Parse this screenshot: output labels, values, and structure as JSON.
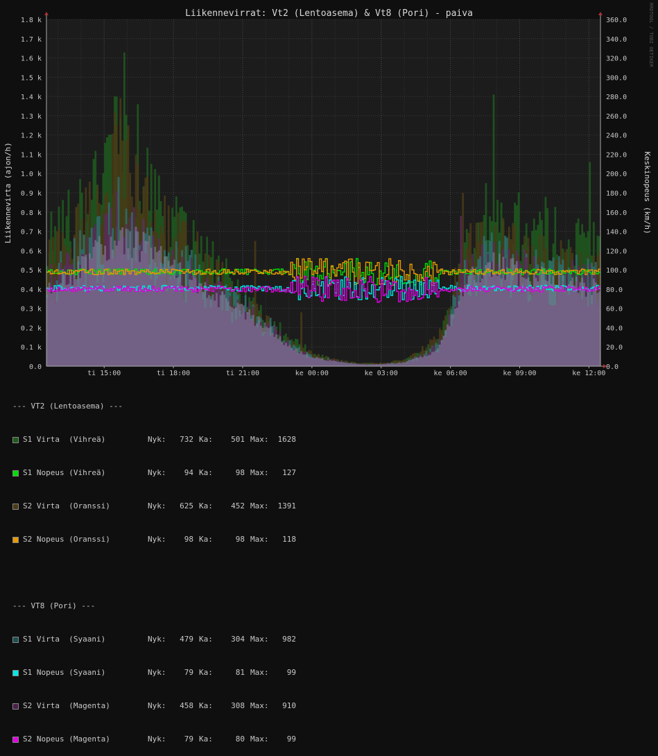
{
  "chart_data": {
    "type": "area",
    "title": "Liikennevirrat: Vt2 (Lentoasema) & Vt8 (Pori) - paiva",
    "watermark": "RRDTOOL / TOBI OETIKER",
    "left_axis": {
      "label": "Liikennevirta (ajon/h)",
      "ticks": [
        "0.0",
        "0.1 k",
        "0.2 k",
        "0.3 k",
        "0.4 k",
        "0.5 k",
        "0.6 k",
        "0.7 k",
        "0.8 k",
        "0.9 k",
        "1.0 k",
        "1.1 k",
        "1.2 k",
        "1.3 k",
        "1.4 k",
        "1.5 k",
        "1.6 k",
        "1.7 k",
        "1.8 k"
      ],
      "range": [
        0,
        1800
      ]
    },
    "right_axis": {
      "label": "Keskinopeus (km/h)",
      "ticks": [
        "0.0",
        "20.0",
        "40.0",
        "60.0",
        "80.0",
        "100.0",
        "120.0",
        "140.0",
        "160.0",
        "180.0",
        "200.0",
        "220.0",
        "240.0",
        "260.0",
        "280.0",
        "300.0",
        "320.0",
        "340.0",
        "360.0"
      ],
      "range": [
        0,
        360
      ]
    },
    "x_axis": {
      "range_hours": [
        12.5,
        36.5
      ],
      "ticks": [
        {
          "h": 15,
          "label": "ti 15:00"
        },
        {
          "h": 18,
          "label": "ti 18:00"
        },
        {
          "h": 21,
          "label": "ti 21:00"
        },
        {
          "h": 24,
          "label": "ke 00:00"
        },
        {
          "h": 27,
          "label": "ke 03:00"
        },
        {
          "h": 30,
          "label": "ke 06:00"
        },
        {
          "h": 33,
          "label": "ke 09:00"
        },
        {
          "h": 36,
          "label": "ke 12:00"
        }
      ]
    },
    "grid": true,
    "series": [
      {
        "id": "s1_virta_vt2",
        "axis": "left",
        "kind": "area",
        "color": "#1f5a1f",
        "profile": [
          [
            12.5,
            600
          ],
          [
            13.5,
            750
          ],
          [
            14.5,
            880
          ],
          [
            15.5,
            1200
          ],
          [
            16.0,
            1000
          ],
          [
            17.0,
            850
          ],
          [
            18.0,
            700
          ],
          [
            19.0,
            580
          ],
          [
            20.0,
            460
          ],
          [
            21.0,
            360
          ],
          [
            22.0,
            250
          ],
          [
            23.0,
            130
          ],
          [
            24.0,
            70
          ],
          [
            25.0,
            30
          ],
          [
            26.0,
            15
          ],
          [
            27.0,
            15
          ],
          [
            28.0,
            30
          ],
          [
            29.0,
            90
          ],
          [
            29.5,
            150
          ],
          [
            30.0,
            300
          ],
          [
            30.5,
            500
          ],
          [
            31.0,
            650
          ],
          [
            31.5,
            700
          ],
          [
            32.0,
            750
          ],
          [
            33.0,
            720
          ],
          [
            34.0,
            680
          ],
          [
            35.0,
            640
          ],
          [
            36.0,
            620
          ],
          [
            36.5,
            600
          ]
        ],
        "peaks": [
          [
            15.8,
            1628
          ],
          [
            15.5,
            1400
          ],
          [
            16.4,
            1360
          ],
          [
            31.8,
            1410
          ],
          [
            31.5,
            950
          ],
          [
            36.0,
            1060
          ],
          [
            17.0,
            1050
          ],
          [
            14.0,
            900
          ]
        ]
      },
      {
        "id": "s2_virta_vt2",
        "axis": "left",
        "kind": "area",
        "color": "#4a3a16",
        "profile": [
          [
            12.5,
            550
          ],
          [
            13.5,
            650
          ],
          [
            14.5,
            800
          ],
          [
            15.5,
            1050
          ],
          [
            16.0,
            950
          ],
          [
            17.0,
            780
          ],
          [
            18.0,
            640
          ],
          [
            19.0,
            540
          ],
          [
            20.0,
            430
          ],
          [
            21.0,
            330
          ],
          [
            22.0,
            220
          ],
          [
            23.0,
            110
          ],
          [
            24.0,
            60
          ],
          [
            25.0,
            30
          ],
          [
            26.0,
            15
          ],
          [
            27.0,
            15
          ],
          [
            28.0,
            30
          ],
          [
            29.0,
            100
          ],
          [
            29.5,
            170
          ],
          [
            30.0,
            330
          ],
          [
            30.5,
            550
          ],
          [
            31.0,
            600
          ],
          [
            31.5,
            600
          ],
          [
            32.0,
            620
          ],
          [
            33.0,
            560
          ],
          [
            34.0,
            520
          ],
          [
            35.0,
            500
          ],
          [
            36.0,
            480
          ],
          [
            36.5,
            470
          ]
        ],
        "peaks": [
          [
            15.7,
            1391
          ],
          [
            16.0,
            1250
          ],
          [
            30.5,
            900
          ],
          [
            21.5,
            650
          ],
          [
            23.5,
            280
          ]
        ]
      },
      {
        "id": "s1_virta_vt8",
        "axis": "left",
        "kind": "area",
        "color": "#2e6f6f",
        "profile": [
          [
            12.5,
            420
          ],
          [
            13.5,
            500
          ],
          [
            14.5,
            620
          ],
          [
            15.5,
            720
          ],
          [
            16.0,
            700
          ],
          [
            17.0,
            620
          ],
          [
            18.0,
            520
          ],
          [
            19.0,
            450
          ],
          [
            20.0,
            370
          ],
          [
            21.0,
            300
          ],
          [
            22.0,
            210
          ],
          [
            23.0,
            110
          ],
          [
            24.0,
            50
          ],
          [
            25.0,
            25
          ],
          [
            26.0,
            10
          ],
          [
            27.0,
            10
          ],
          [
            28.0,
            20
          ],
          [
            29.0,
            70
          ],
          [
            29.5,
            120
          ],
          [
            30.0,
            260
          ],
          [
            30.5,
            420
          ],
          [
            31.0,
            520
          ],
          [
            31.5,
            560
          ],
          [
            32.0,
            560
          ],
          [
            33.0,
            520
          ],
          [
            34.0,
            480
          ],
          [
            35.0,
            460
          ],
          [
            36.0,
            440
          ],
          [
            36.5,
            430
          ]
        ],
        "peaks": [
          [
            15.6,
            982
          ],
          [
            15.2,
            850
          ]
        ]
      },
      {
        "id": "s2_virta_vt8",
        "axis": "left",
        "kind": "area",
        "color": "#5a2a5a",
        "profile": [
          [
            12.5,
            400
          ],
          [
            13.5,
            470
          ],
          [
            14.5,
            580
          ],
          [
            15.5,
            680
          ],
          [
            16.0,
            660
          ],
          [
            17.0,
            590
          ],
          [
            18.0,
            500
          ],
          [
            19.0,
            430
          ],
          [
            20.0,
            350
          ],
          [
            21.0,
            280
          ],
          [
            22.0,
            200
          ],
          [
            23.0,
            100
          ],
          [
            24.0,
            45
          ],
          [
            25.0,
            25
          ],
          [
            26.0,
            10
          ],
          [
            27.0,
            10
          ],
          [
            28.0,
            20
          ],
          [
            29.0,
            60
          ],
          [
            29.5,
            110
          ],
          [
            30.0,
            240
          ],
          [
            30.5,
            420
          ],
          [
            31.0,
            500
          ],
          [
            31.5,
            520
          ],
          [
            32.0,
            520
          ],
          [
            33.0,
            480
          ],
          [
            34.0,
            450
          ],
          [
            35.0,
            430
          ],
          [
            36.0,
            420
          ],
          [
            36.5,
            410
          ]
        ],
        "peaks": [
          [
            15.5,
            910
          ],
          [
            30.4,
            780
          ]
        ]
      },
      {
        "id": "s1_nopeus_vt2",
        "axis": "right",
        "kind": "line",
        "color": "#00e000",
        "base": 98,
        "noise": 3,
        "night_noise": 14
      },
      {
        "id": "s2_nopeus_vt2",
        "axis": "right",
        "kind": "line",
        "color": "#e89a00",
        "base": 98,
        "noise": 3,
        "night_noise": 14
      },
      {
        "id": "s1_nopeus_vt8",
        "axis": "right",
        "kind": "line",
        "color": "#00e8e8",
        "base": 81,
        "noise": 3,
        "night_noise": 12
      },
      {
        "id": "s2_nopeus_vt8",
        "axis": "right",
        "kind": "line",
        "color": "#e000e0",
        "base": 80,
        "noise": 3,
        "night_noise": 14
      }
    ]
  },
  "legend": {
    "groups": [
      {
        "header": "--- VT2 (Lentoasema) ---",
        "rows": [
          {
            "name": "S1 Virta  (Vihreä)",
            "color": "#1f5a1f",
            "nyk": "732",
            "ka": "501",
            "max": "1628"
          },
          {
            "name": "S1 Nopeus (Vihreä)",
            "color": "#00e000",
            "nyk": "94",
            "ka": "98",
            "max": "127"
          },
          {
            "name": "S2 Virta  (Oranssi)",
            "color": "#4a3a16",
            "nyk": "625",
            "ka": "452",
            "max": "1391"
          },
          {
            "name": "S2 Nopeus (Oranssi)",
            "color": "#e89a00",
            "nyk": "98",
            "ka": "98",
            "max": "118"
          }
        ]
      },
      {
        "header": "--- VT8 (Pori) ---",
        "rows": [
          {
            "name": "S1 Virta  (Syaani)",
            "color": "#1e4f4f",
            "nyk": "479",
            "ka": "304",
            "max": "982"
          },
          {
            "name": "S1 Nopeus (Syaani)",
            "color": "#00e8e8",
            "nyk": "79",
            "ka": "81",
            "max": "99"
          },
          {
            "name": "S2 Virta  (Magenta)",
            "color": "#4a1f4a",
            "nyk": "458",
            "ka": "308",
            "max": "910"
          },
          {
            "name": "S2 Nopeus (Magenta)",
            "color": "#e000e0",
            "nyk": "79",
            "ka": "80",
            "max": "99"
          }
        ]
      }
    ],
    "labels": {
      "nyk": "Nyk:",
      "ka": "Ka:",
      "max": "Max:"
    }
  }
}
